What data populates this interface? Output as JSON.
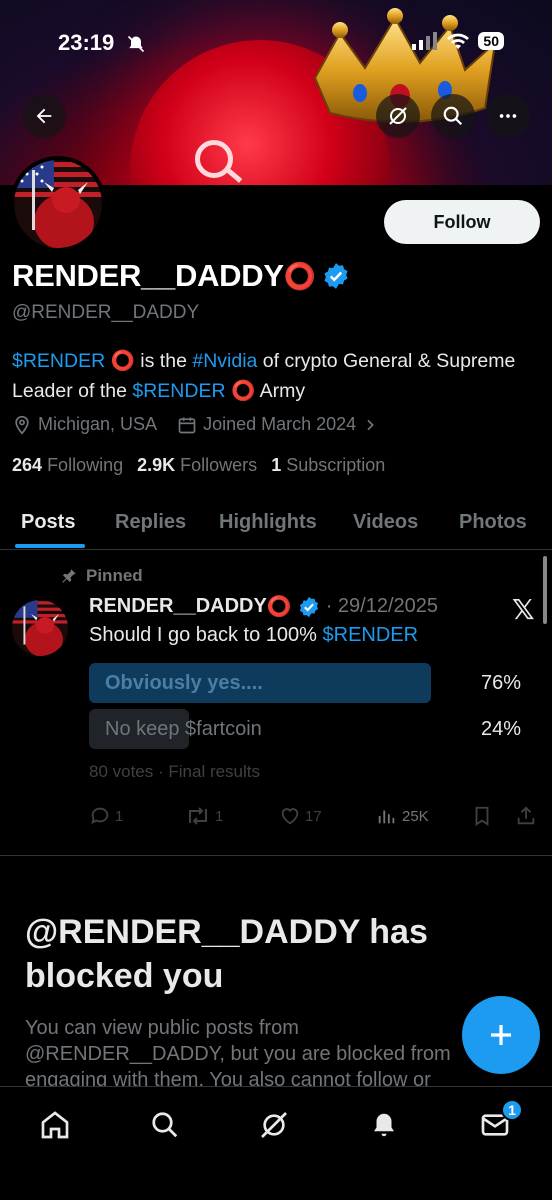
{
  "status_bar": {
    "time": "23:19",
    "battery": "50"
  },
  "profile": {
    "display_name": "RENDER__DADDY",
    "name_emoji": "⭕",
    "handle": "@RENDER__DADDY",
    "follow_label": "Follow",
    "bio": {
      "tag1": "$RENDER",
      "emoji": "⭕",
      "text1": " is the ",
      "tag2": "#Nvidia",
      "text2": " of crypto General & Supreme Leader of the ",
      "tag3": "$RENDER",
      "text3": " Army"
    },
    "location": "Michigan, USA",
    "joined": "Joined March 2024",
    "following_count": "264",
    "following_label": "Following",
    "followers_count": "2.9K",
    "followers_label": "Followers",
    "subscription_count": "1",
    "subscription_label": "Subscription"
  },
  "tabs": [
    "Posts",
    "Replies",
    "Highlights",
    "Videos",
    "Photos"
  ],
  "post": {
    "pinned_label": "Pinned",
    "author": "RENDER__DADDY",
    "author_emoji": "⭕",
    "date": "· 29/12/2025",
    "x_logo": "𝕏",
    "text_prefix": "Should I go back to 100% ",
    "text_tag": "$RENDER",
    "poll": [
      {
        "label": "Obviously yes....",
        "pct": "76%",
        "fraction": 0.76,
        "leading": true
      },
      {
        "label": "No keep $fartcoin",
        "pct": "24%",
        "fraction": 0.24,
        "leading": false
      }
    ],
    "votes": "80 votes · Final results",
    "replies": "1",
    "reposts": "1",
    "likes": "17",
    "views": "25K"
  },
  "blocked": {
    "title": "@RENDER__DADDY has blocked you",
    "text": "You can view public posts from @RENDER__DADDY, but you are blocked from engaging with them. You also cannot follow or"
  },
  "nav": {
    "messages_badge": "1"
  },
  "colors": {
    "accent": "#1d9bf0",
    "background": "#000000",
    "muted": "#71767b"
  }
}
